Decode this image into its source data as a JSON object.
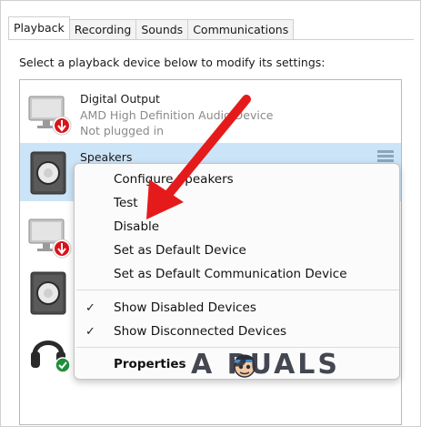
{
  "tabs": [
    {
      "label": "Playback",
      "active": true
    },
    {
      "label": "Recording",
      "active": false
    },
    {
      "label": "Sounds",
      "active": false
    },
    {
      "label": "Communications",
      "active": false
    }
  ],
  "instruction": "Select a playback device below to modify its settings:",
  "devices": [
    {
      "name": "Digital Output",
      "line1": "AMD High Definition Audio Device",
      "line2": "Not plugged in",
      "icon": "monitor-speaker-icon",
      "status_icon": "red-down-arrow-icon"
    },
    {
      "name": "Speakers",
      "selected": true,
      "icon": "speaker-icon",
      "right_icon": "volume-level-icon"
    },
    {
      "name": "",
      "icon": "monitor-speaker-icon",
      "status_icon": "red-down-arrow-icon"
    },
    {
      "name": "",
      "icon": "speaker-icon"
    },
    {
      "name": "",
      "icon": "headphones-icon",
      "status_icon": "green-check-icon"
    }
  ],
  "context_menu": {
    "items": [
      {
        "label": "Configure Speakers",
        "checked": false,
        "bold": false
      },
      {
        "label": "Test",
        "checked": false,
        "bold": false
      },
      {
        "label": "Disable",
        "checked": false,
        "bold": false
      },
      {
        "label": "Set as Default Device",
        "checked": false,
        "bold": false
      },
      {
        "label": "Set as Default Communication Device",
        "checked": false,
        "bold": false
      },
      {
        "label": "Show Disabled Devices",
        "checked": true,
        "bold": false
      },
      {
        "label": "Show Disconnected Devices",
        "checked": true,
        "bold": false
      },
      {
        "label": "Properties",
        "checked": false,
        "bold": true
      }
    ],
    "check_glyph": "✓"
  },
  "annotation": {
    "arrow_color": "#e51b1b"
  },
  "watermark": {
    "text": "A PUALS"
  },
  "colors": {
    "selection": "#cce4f7",
    "accent_red": "#e51b1b",
    "check_green": "#1f8f3a"
  }
}
